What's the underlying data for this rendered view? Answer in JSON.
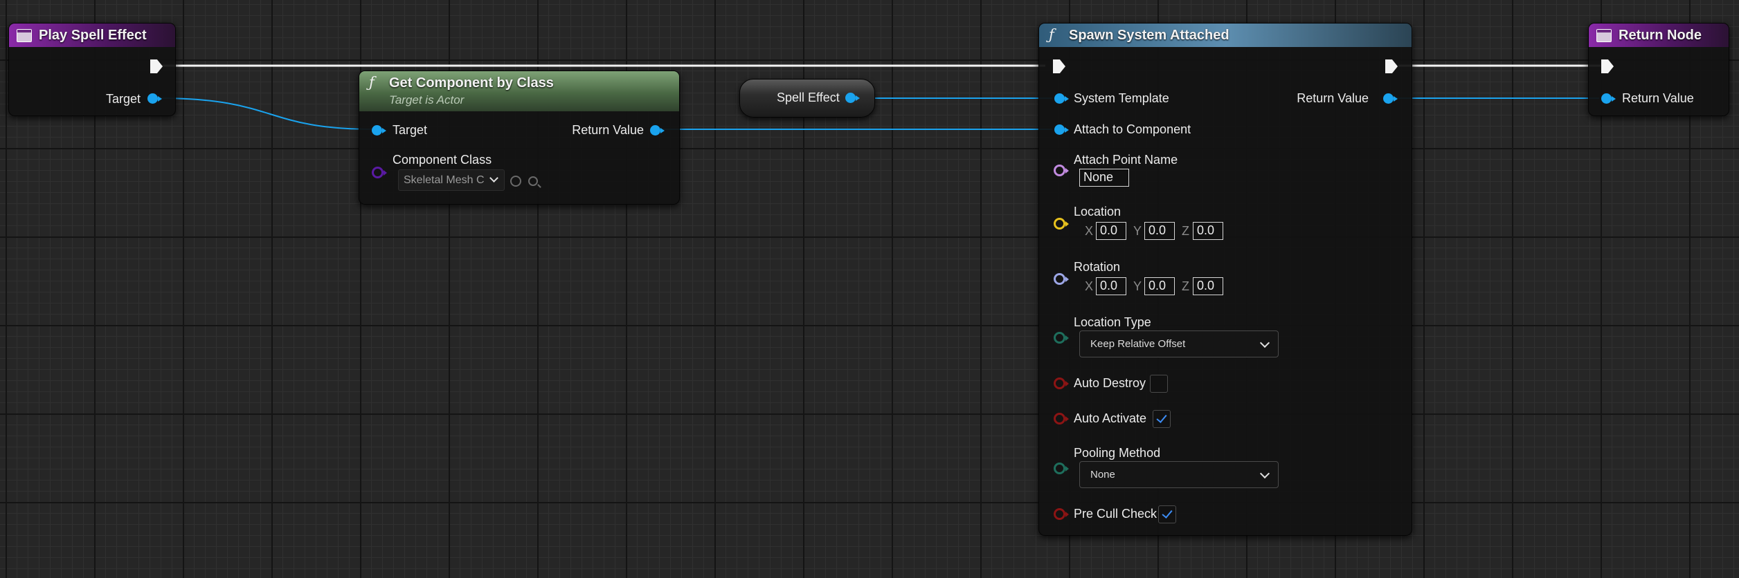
{
  "play_node": {
    "title": "Play Spell Effect",
    "target_label": "Target"
  },
  "get_node": {
    "title": "Get Component by Class",
    "subtitle": "Target is Actor",
    "target_label": "Target",
    "return_label": "Return Value",
    "class_label": "Component Class",
    "class_value": "Skeletal Mesh C"
  },
  "variable": {
    "label": "Spell Effect"
  },
  "spawn_node": {
    "title": "Spawn System Attached",
    "system_template": "System Template",
    "return_label": "Return Value",
    "attach_component": "Attach to Component",
    "attach_point": "Attach Point Name",
    "attach_point_value": "None",
    "location": "Location",
    "rotation": "Rotation",
    "axis_x": "X",
    "axis_y": "Y",
    "axis_z": "Z",
    "loc_x": "0.0",
    "loc_y": "0.0",
    "loc_z": "0.0",
    "rot_x": "0.0",
    "rot_y": "0.0",
    "rot_z": "0.0",
    "location_type": "Location Type",
    "location_type_value": "Keep Relative Offset",
    "auto_destroy": "Auto Destroy",
    "auto_destroy_checked": false,
    "auto_activate": "Auto Activate",
    "auto_activate_checked": true,
    "pooling": "Pooling Method",
    "pooling_value": "None",
    "pre_cull": "Pre Cull Check",
    "pre_cull_checked": true
  },
  "return_node": {
    "title": "Return Node",
    "return_label": "Return Value"
  },
  "colors": {
    "object_pin": "#1aa3ee",
    "exec_wire": "#f4f4f4",
    "name_pin": "#c28be0",
    "vector_pin": "#e8c21e",
    "rotator_pin": "#9ca6e6",
    "enum_pin": "#1e6e5c",
    "bool_pin": "#8c1414",
    "class_pin": "#5a1aa3"
  }
}
